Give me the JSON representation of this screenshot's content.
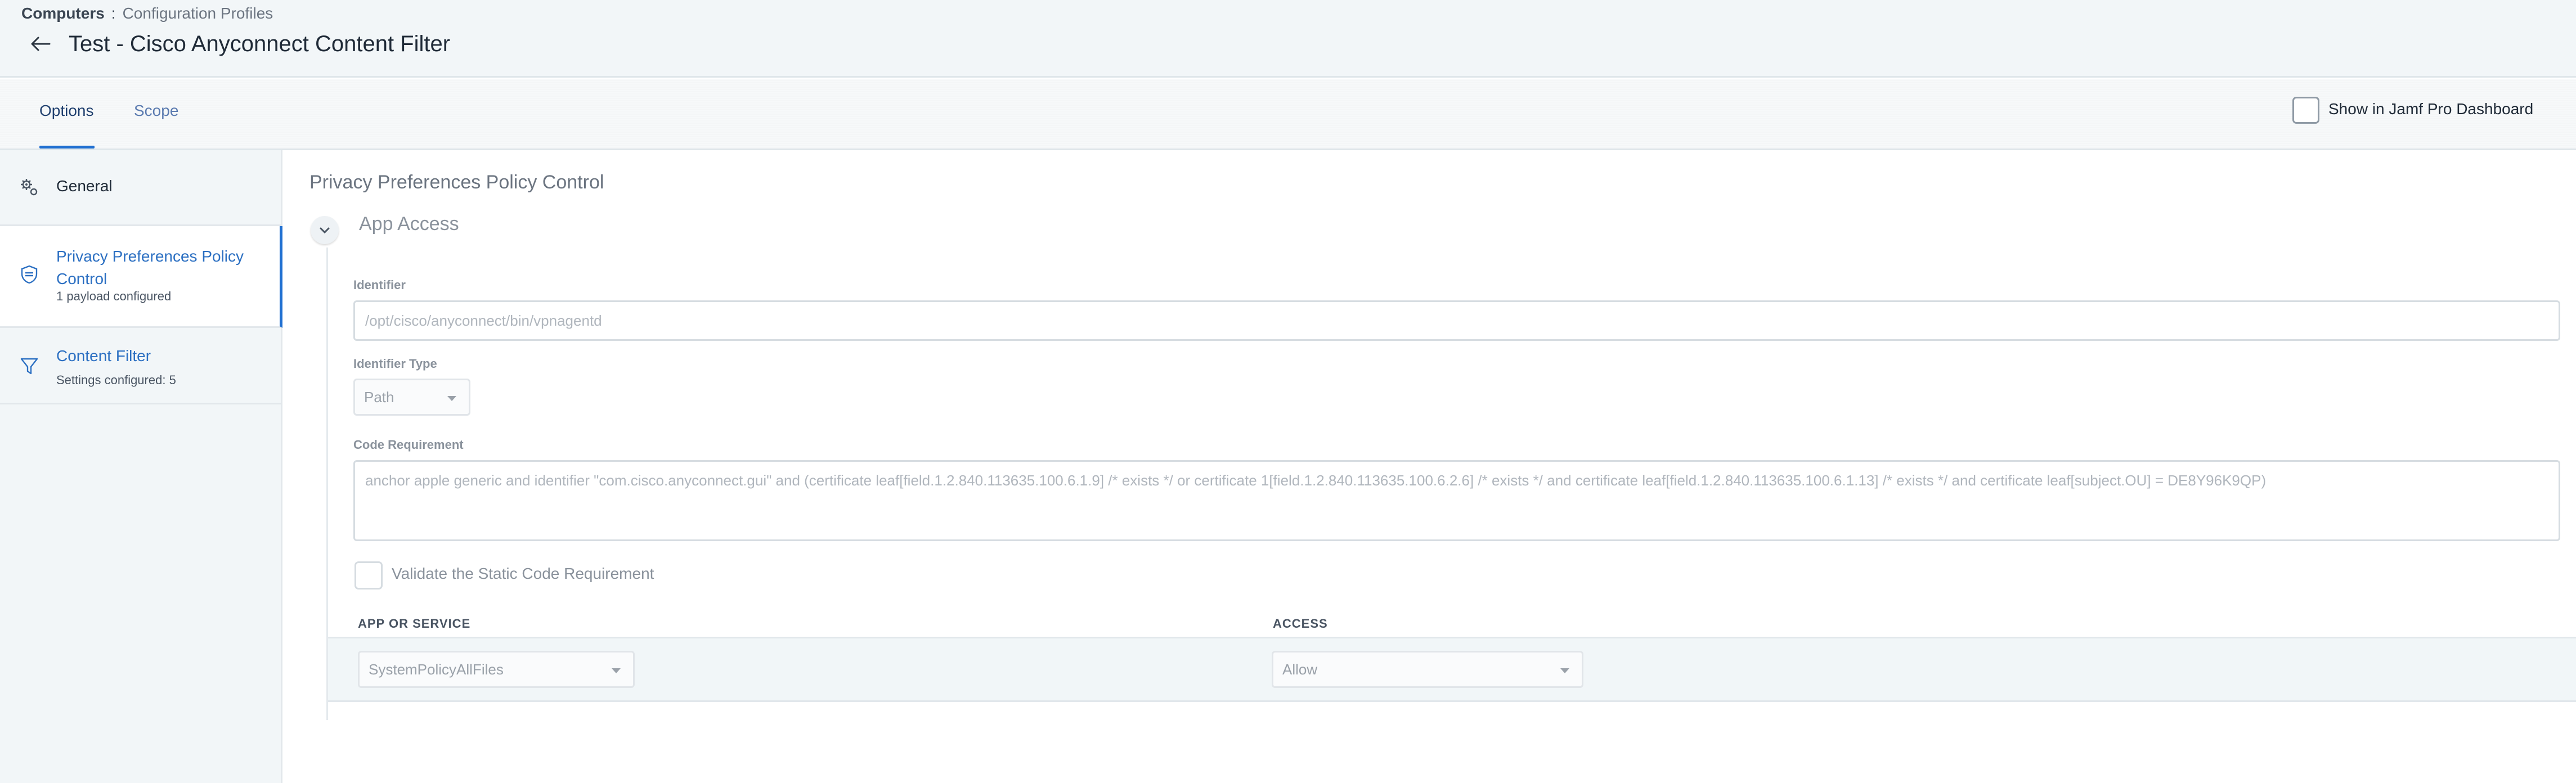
{
  "breadcrumb": {
    "root": "Computers",
    "separator": ":",
    "current": "Configuration Profiles"
  },
  "page": {
    "title": "Test - Cisco Anyconnect Content Filter",
    "back_icon": "arrow-left-icon"
  },
  "tabs": [
    {
      "label": "Options",
      "active": true
    },
    {
      "label": "Scope",
      "active": false
    }
  ],
  "dashboard": {
    "label": "Show in Jamf Pro Dashboard",
    "checked": false
  },
  "sidebar": {
    "items": [
      {
        "title": "General",
        "icon": "gear-cog-icon"
      },
      {
        "title": "Privacy Preferences Policy Control",
        "subtitle": "1 payload configured",
        "icon": "shield-icon",
        "active": true
      },
      {
        "title": "Content Filter",
        "subtitle": "Settings configured: 5",
        "icon": "funnel-filter-icon"
      }
    ]
  },
  "main": {
    "title": "Privacy Preferences Policy Control",
    "section_title": "App Access",
    "identifier": {
      "label": "Identifier",
      "value": "/opt/cisco/anyconnect/bin/vpnagentd"
    },
    "identifier_type": {
      "label": "Identifier Type",
      "value": "Path"
    },
    "code_requirement": {
      "label": "Code Requirement",
      "value": "anchor apple generic and identifier \"com.cisco.anyconnect.gui\" and (certificate leaf[field.1.2.840.113635.100.6.1.9] /* exists */ or certificate 1[field.1.2.840.113635.100.6.2.6] /* exists */ and certificate leaf[field.1.2.840.113635.100.6.1.13] /* exists */ and certificate leaf[subject.OU] = DE8Y96K9QP)"
    },
    "validate": {
      "label": "Validate the Static Code Requirement",
      "checked": false
    },
    "table": {
      "headers": [
        "APP OR SERVICE",
        "ACCESS"
      ],
      "rows": [
        {
          "service": "SystemPolicyAllFiles",
          "access": "Allow"
        }
      ]
    }
  },
  "colors": {
    "accent": "#1f6fd1",
    "link": "#2b6fc2",
    "header_bg": "#f2f6f8"
  }
}
